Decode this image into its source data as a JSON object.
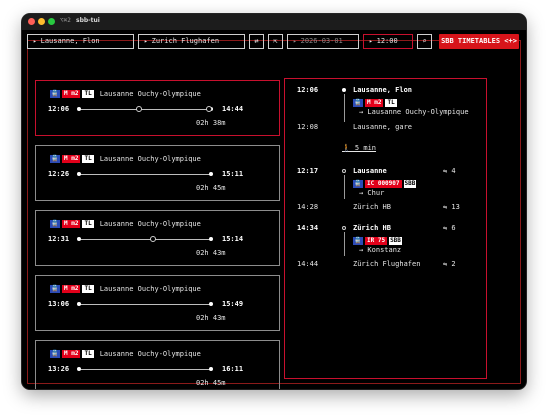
{
  "window": {
    "shortcut": "⌥⌘2",
    "title": "sbb-tui"
  },
  "search": {
    "from": "Lausanne, Flon",
    "to": "Zurich Flughafen",
    "swap_icon": "⇄",
    "arrival_icon": "⇱",
    "date": "2026-03-01",
    "time": "12:00",
    "search_icon": "⌕",
    "app_button": "SBB TIMETABLES <+>"
  },
  "connections": [
    {
      "vehicle_icon": "🚆",
      "m": "M m2",
      "tl": "TL",
      "dest": "Lausanne Ouchy-Olympique",
      "dep": "12:06",
      "arr": "14:44",
      "duration": "02h 38m",
      "changes_pos": [
        0.45,
        0.98
      ],
      "selected": true
    },
    {
      "vehicle_icon": "🚆",
      "m": "M m2",
      "tl": "TL",
      "dest": "Lausanne Ouchy-Olympique",
      "dep": "12:26",
      "arr": "15:11",
      "duration": "02h 45m",
      "changes_pos": [],
      "selected": false
    },
    {
      "vehicle_icon": "🚆",
      "m": "M m2",
      "tl": "TL",
      "dest": "Lausanne Ouchy-Olympique",
      "dep": "12:31",
      "arr": "15:14",
      "duration": "02h 43m",
      "changes_pos": [
        0.55
      ],
      "selected": false
    },
    {
      "vehicle_icon": "🚆",
      "m": "M m2",
      "tl": "TL",
      "dest": "Lausanne Ouchy-Olympique",
      "dep": "13:06",
      "arr": "15:49",
      "duration": "02h 43m",
      "changes_pos": [],
      "selected": false
    },
    {
      "vehicle_icon": "🚆",
      "m": "M m2",
      "tl": "TL",
      "dest": "Lausanne Ouchy-Olympique",
      "dep": "13:26",
      "arr": "16:11",
      "duration": "02h 45m",
      "changes_pos": [],
      "selected": false
    }
  ],
  "detail": {
    "leg1": {
      "dep_time": "12:06",
      "dep_stop": "Lausanne, Flon",
      "vehicle_icon": "🚆",
      "m": "M m2",
      "tl": "TL",
      "direction": "→ Lausanne Ouchy-Olympique",
      "arr_time": "12:08",
      "arr_stop": "Lausanne, gare"
    },
    "walk": "🚶 5 min",
    "leg2": {
      "dep_time": "12:17",
      "dep_stop": "Lausanne",
      "dep_plat": "⇋ 4",
      "vehicle_icon": "🚆",
      "line": "IC 000907",
      "operator": "SBB",
      "direction": "→ Chur",
      "arr_time": "14:28",
      "arr_stop": "Zürich HB",
      "arr_plat": "⇋ 13"
    },
    "leg3": {
      "dep_time": "14:34",
      "dep_stop": "Zürich HB",
      "dep_plat": "⇋ 6",
      "vehicle_icon": "🚆",
      "line": "IR 75",
      "operator": "SBB",
      "direction": "→ Konstanz",
      "arr_time": "14:44",
      "arr_stop": "Zürich Flughafen",
      "arr_plat": "⇋ 2"
    }
  },
  "colors": {
    "accent": "#d7141a",
    "background": "#000000",
    "text": "#e6e6e6"
  }
}
